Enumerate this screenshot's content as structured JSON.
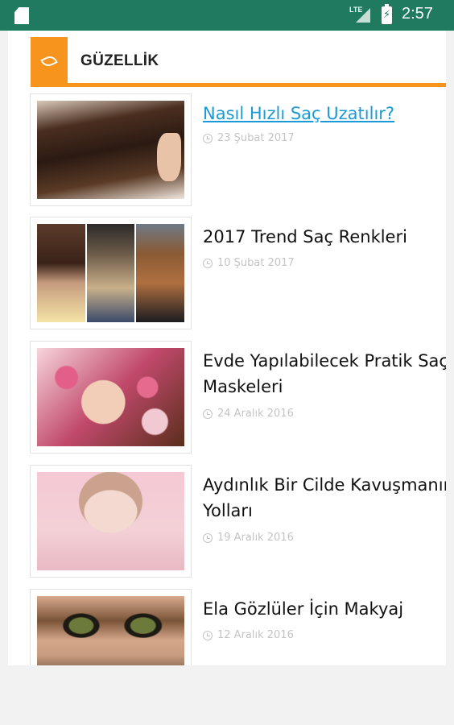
{
  "status_bar": {
    "network": "LTE",
    "time": "2:57",
    "sd_icon": "sd-card-icon",
    "signal_icon": "signal-icon",
    "battery_icon": "battery-charging-icon"
  },
  "section": {
    "title": "GÜZELLİK",
    "icon": "leaf-icon",
    "accent_color": "#f7941d"
  },
  "articles": [
    {
      "title": "Nasıl Hızlı Saç Uzatılır?",
      "date": "23 Şubat 2017",
      "is_link": true
    },
    {
      "title": "2017 Trend Saç Renkleri",
      "date": "10 Şubat 2017"
    },
    {
      "title": "Evde Yapılabilecek Pratik Saç",
      "title2": "Maskeleri",
      "date": "24 Aralık 2016"
    },
    {
      "title": "Aydınlık Bir Cilde Kavuşmanın",
      "title2": "Yolları",
      "date": "19 Aralık 2016"
    },
    {
      "title": "Ela Gözlüler İçin Makyaj",
      "date": "12 Aralık 2016"
    }
  ],
  "colors": {
    "status_bar": "#1f7a60",
    "link": "#1a9ad6",
    "date_text": "#c4c4c4"
  }
}
